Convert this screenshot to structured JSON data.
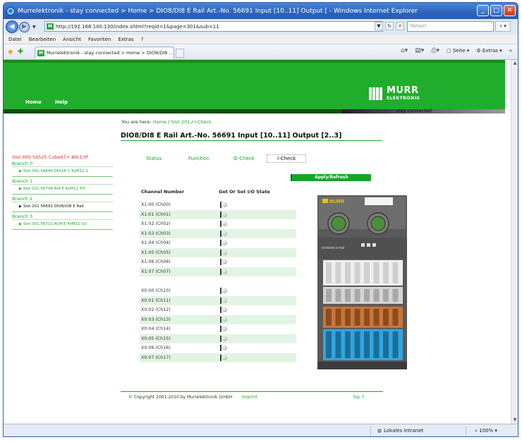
{
  "window": {
    "title": "Murrelektronik - stay connected > Home > DIO8/DI8 E Rail Art.-No. 56691 Input [10..11] Output [ - Windows Internet Explorer"
  },
  "address": {
    "url": "http://192.168.100.130/index.shtml?reqid=1&page=301&sub=11",
    "search_placeholder": "Yahoo!"
  },
  "menu": [
    "Datei",
    "Bearbeiten",
    "Ansicht",
    "Favoriten",
    "Extras",
    "?"
  ],
  "browser_tab": {
    "label": "Murrelektronik - stay connected > Home > DIO8/DI8 ..."
  },
  "toolbar": {
    "page_label": "Seite",
    "extras_label": "Extras"
  },
  "status": {
    "zone": "Lokales Intranet",
    "zoom": "100%"
  },
  "site": {
    "nav": [
      "Home",
      "Help"
    ],
    "logo_main": "MURR",
    "logo_sub": "ELEKTRONIK",
    "tagline": "stay connected",
    "breadcrumb_prefix": "You are here: ",
    "breadcrumb": [
      "Home",
      "Slot 201",
      "I-Check"
    ],
    "page_title": "DIO8/DI8 E Rail Art.-No. 56691 Input [10..11] Output [2..3]"
  },
  "sidebar": {
    "top_slot": "Slot 000 56525 Cube67+ BN-E/IP",
    "branches": [
      {
        "label": "Branch 0",
        "item": "Slot 001 56640 DIO16 C 8xM12 1.",
        "active": false
      },
      {
        "label": "Branch 1",
        "item": "Slot 101 56749 AI4 E 4xM12 TH",
        "active": false
      },
      {
        "label": "Branch 2",
        "item": "Slot 201 56691 DIO8/DI8 E Rail",
        "active": true
      },
      {
        "label": "Branch 3",
        "item": "Slot 301 56711 AO4 E 4xM12 (U)",
        "active": false
      }
    ]
  },
  "tabs": [
    "Status",
    "Function",
    "O-Check",
    "I-Check"
  ],
  "apply_button": "Apply/Refresh",
  "columns": {
    "channel": "Channel Number",
    "state": "Get Or Set I/O State"
  },
  "channels": [
    "X1:00 (Ch00)",
    "X1:01 (Ch01)",
    "X1:02 (Ch02)",
    "X1:03 (Ch03)",
    "X1:04 (Ch04)",
    "X1:05 (Ch05)",
    "X1:06 (Ch06)",
    "X1:07 (Ch07)",
    "X0:00 (Ch10)",
    "X0:01 (Ch11)",
    "X0:02 (Ch12)",
    "X0:03 (Ch13)",
    "X0:04 (Ch14)",
    "X0:05 (Ch15)",
    "X0:06 (Ch16)",
    "X0:07 (Ch17)"
  ],
  "device_image": {
    "logo_text": "MURR",
    "model_text": "DIO8/DI8 E Rail"
  },
  "footer": {
    "copyright": "© Copyright 2001-2010 by Murrelektronik GmbH",
    "imprint": "Imprint",
    "top": "Top ↑"
  },
  "colors": {
    "brand_green": "#21ad2c",
    "link_green": "#1aa427",
    "dark_green": "#0f4d12",
    "alert_red": "#e4292b"
  }
}
